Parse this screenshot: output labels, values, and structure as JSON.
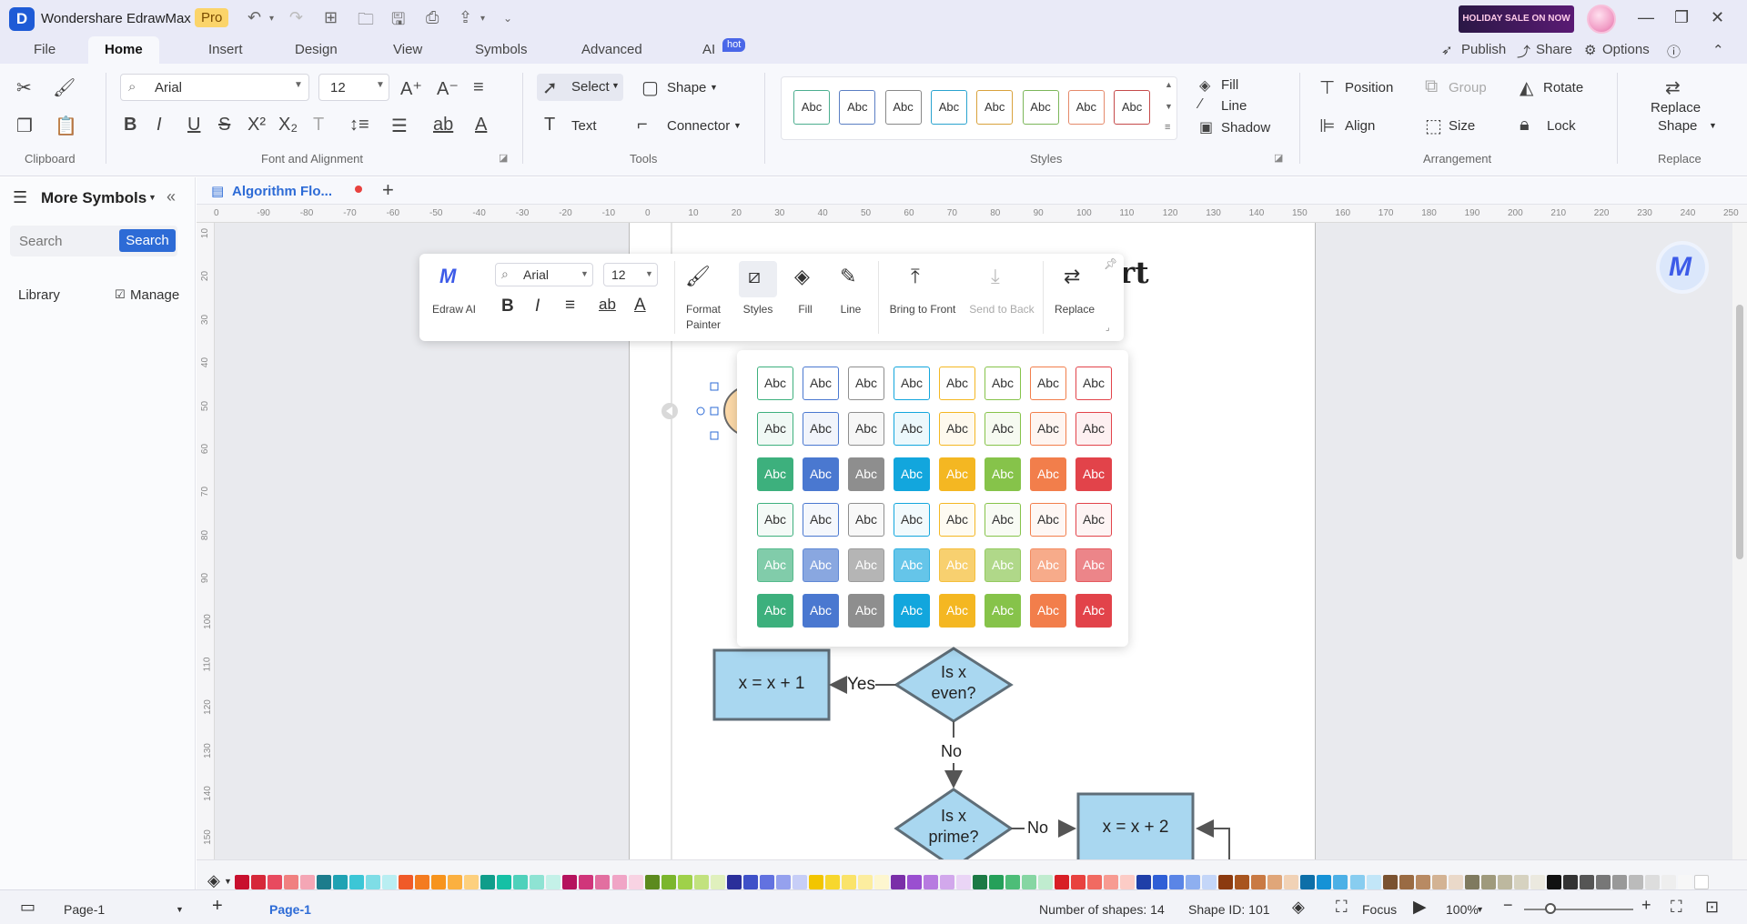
{
  "app": {
    "title": "Wondershare EdrawMax",
    "badge": "Pro",
    "holiday_banner": "HOLIDAY SALE ON NOW",
    "logo_glyph": "D"
  },
  "menu": {
    "tabs": [
      "File",
      "Home",
      "Insert",
      "Design",
      "View",
      "Symbols",
      "Advanced",
      "AI"
    ],
    "active": "Home",
    "ai_badge": "hot",
    "publish": "Publish",
    "share": "Share",
    "options": "Options"
  },
  "ribbon": {
    "font_family": "Arial",
    "font_size": "12",
    "select": "Select",
    "shape": "Shape",
    "text": "Text",
    "connector": "Connector",
    "style_label": "Abc",
    "fill": "Fill",
    "line": "Line",
    "shadow": "Shadow",
    "position": "Position",
    "group": "Group",
    "rotate": "Rotate",
    "align": "Align",
    "size": "Size",
    "lock": "Lock",
    "replace_shape_1": "Replace",
    "replace_shape_2": "Shape",
    "groups": {
      "clipboard": "Clipboard",
      "font_alignment": "Font and Alignment",
      "tools": "Tools",
      "styles": "Styles",
      "arrangement": "Arrangement",
      "replace": "Replace"
    },
    "style_border_colors": [
      "#4cae8f",
      "#5a7ec3",
      "#888888",
      "#2aa3cf",
      "#d9a23c",
      "#7cb65a",
      "#e58a6b",
      "#c54a4a"
    ]
  },
  "left_panel": {
    "title": "More Symbols",
    "search_placeholder": "Search",
    "search_button": "Search",
    "library": "Library",
    "manage": "Manage"
  },
  "document": {
    "tab_title": "Algorithm Flo...",
    "title_fragment": "rt",
    "h_ruler": [
      "0",
      "-90",
      "-80",
      "-70",
      "-60",
      "-50",
      "-40",
      "-30",
      "-20",
      "-10",
      "0",
      "10",
      "20",
      "30",
      "40",
      "50",
      "60",
      "70",
      "80",
      "90",
      "100",
      "110",
      "120",
      "130",
      "140",
      "150",
      "160",
      "170",
      "180",
      "190",
      "200",
      "210",
      "220",
      "230",
      "240",
      "250"
    ],
    "v_ruler": [
      "10",
      "20",
      "30",
      "40",
      "50",
      "60",
      "70",
      "80",
      "90",
      "100",
      "110",
      "120",
      "130",
      "140",
      "150"
    ]
  },
  "flowchart": {
    "box1": "x = x + 1",
    "yes_label": "Yes",
    "diamond1_l1": "Is x",
    "diamond1_l2": "even?",
    "no_label1": "No",
    "diamond2_l1": "Is x",
    "diamond2_l2": "prime?",
    "no_label2": "No",
    "box2": "x = x + 2"
  },
  "floating_toolbar": {
    "edraw_ai": "Edraw AI",
    "font": "Arial",
    "size": "12",
    "format_painter_1": "Format",
    "format_painter_2": "Painter",
    "styles": "Styles",
    "fill": "Fill",
    "line": "Line",
    "bring_to_front": "Bring to Front",
    "send_to_back": "Send to Back",
    "replace": "Replace"
  },
  "style_popup": {
    "label": "Abc",
    "colors": [
      "#3db07d",
      "#4a78d0",
      "#8e8e8e",
      "#12a6dd",
      "#f4b722",
      "#86c34a",
      "#f27e4b",
      "#e2434a"
    ]
  },
  "palette": [
    "#c8102e",
    "#d62839",
    "#e84a5f",
    "#f08080",
    "#f4a6b5",
    "#1c7c8c",
    "#1fa2b3",
    "#3cc6d6",
    "#7fdde6",
    "#b9eef2",
    "#f05a28",
    "#f47b20",
    "#f7941d",
    "#fbb040",
    "#fdd07e",
    "#0f9d8a",
    "#16c0a5",
    "#4fd1bb",
    "#8ee3d3",
    "#c4f1e8",
    "#b5125d",
    "#d0357a",
    "#e26fa0",
    "#f0a5c6",
    "#f8d3e3",
    "#5c8a1e",
    "#7bb62d",
    "#9fd14a",
    "#c2e27f",
    "#e0f0bd",
    "#2b2f9a",
    "#3f51c8",
    "#6272e0",
    "#95a1ee",
    "#c7cef7",
    "#f2c500",
    "#f7d72e",
    "#fae36a",
    "#fced9f",
    "#fdf6cf",
    "#7a2fa8",
    "#9a4fd0",
    "#b77be0",
    "#d2a8ec",
    "#ead5f6",
    "#1c7a45",
    "#25a05a",
    "#4dbd78",
    "#86d6a3",
    "#c0eccf",
    "#d81f26",
    "#e8423f",
    "#f16a61",
    "#f79b92",
    "#fcccc6",
    "#1f3fa8",
    "#2f5fd6",
    "#5a85e6",
    "#8eaff0",
    "#c4d6f8",
    "#8b3a0f",
    "#a8551f",
    "#c97a44",
    "#e0a679",
    "#f1d2b6",
    "#0d6fa8",
    "#1692d6",
    "#4cb0e6",
    "#88cdf0",
    "#c2e6f8",
    "#7a5230",
    "#9a6b43",
    "#b88a63",
    "#d3b394",
    "#ead9c9",
    "#7f7a5f",
    "#9f9a7c",
    "#bdb89f",
    "#d6d2c0",
    "#ebe9df",
    "#111111",
    "#333333",
    "#555555",
    "#777777",
    "#999999",
    "#bbbbbb",
    "#dddddd",
    "#eeeeee",
    "#f7f7f7",
    "#ffffff"
  ],
  "status": {
    "page_selector": "Page-1",
    "page_tab": "Page-1",
    "num_shapes": "Number of shapes: 14",
    "shape_id": "Shape ID: 101",
    "focus": "Focus",
    "zoom": "100%"
  }
}
